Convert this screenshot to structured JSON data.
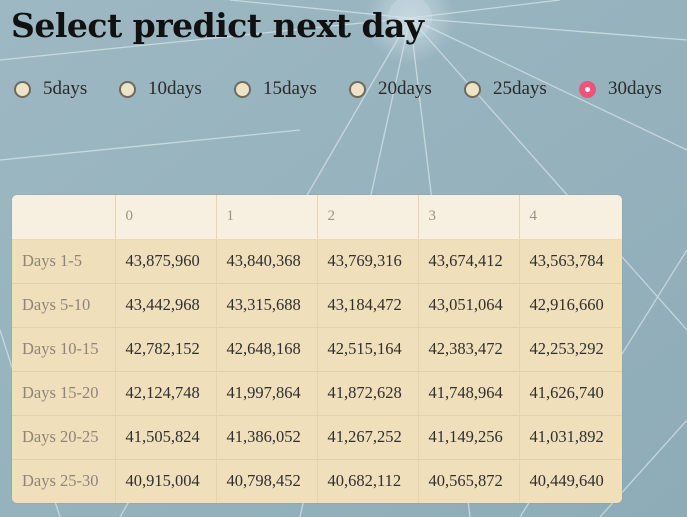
{
  "page": {
    "title": "Select predict next day"
  },
  "radio": {
    "options": [
      {
        "label": "5days",
        "checked": false
      },
      {
        "label": "10days",
        "checked": false
      },
      {
        "label": "15days",
        "checked": false
      },
      {
        "label": "20days",
        "checked": false
      },
      {
        "label": "25days",
        "checked": false
      },
      {
        "label": "30days",
        "checked": true
      }
    ],
    "selected": "30days"
  },
  "table": {
    "columns": [
      "",
      "0",
      "1",
      "2",
      "3",
      "4"
    ],
    "rows": [
      {
        "label": "Days 1-5",
        "values": [
          "43,875,960",
          "43,840,368",
          "43,769,316",
          "43,674,412",
          "43,563,784"
        ]
      },
      {
        "label": "Days 5-10",
        "values": [
          "43,442,968",
          "43,315,688",
          "43,184,472",
          "43,051,064",
          "42,916,660"
        ]
      },
      {
        "label": "Days 10-15",
        "values": [
          "42,782,152",
          "42,648,168",
          "42,515,164",
          "42,383,472",
          "42,253,292"
        ]
      },
      {
        "label": "Days 15-20",
        "values": [
          "42,124,748",
          "41,997,864",
          "41,872,628",
          "41,748,964",
          "41,626,740"
        ]
      },
      {
        "label": "Days 20-25",
        "values": [
          "41,505,824",
          "41,386,052",
          "41,267,252",
          "41,149,256",
          "41,031,892"
        ]
      },
      {
        "label": "Days 25-30",
        "values": [
          "40,915,004",
          "40,798,452",
          "40,682,112",
          "40,565,872",
          "40,449,640"
        ]
      }
    ]
  },
  "colors": {
    "background": "#95b2bd",
    "radio_selected": "#f0527a",
    "table_header": "#f7efdf",
    "table_body": "#f0dfbb"
  }
}
